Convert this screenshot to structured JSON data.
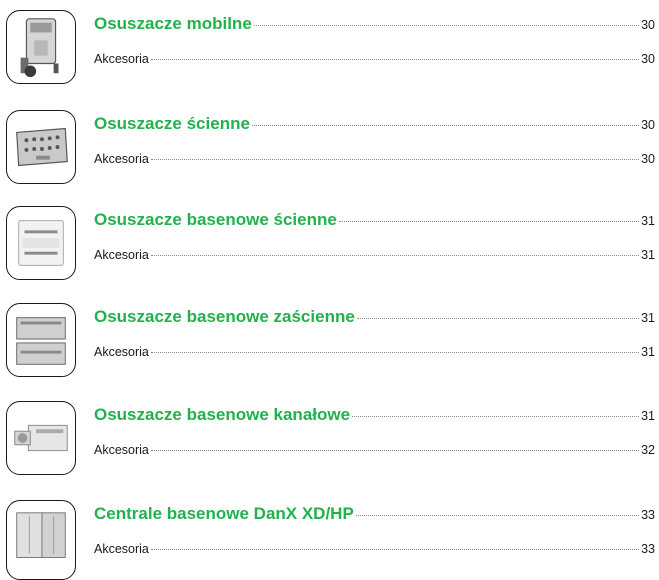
{
  "sections": [
    {
      "title": "Osuszacze mobilne",
      "title_page": "30",
      "sub_label": "Akcesoria",
      "sub_page": "30",
      "image": "mobile-dehumidifier-icon"
    },
    {
      "title": "Osuszacze ścienne",
      "title_page": "30",
      "sub_label": "Akcesoria",
      "sub_page": "30",
      "image": "wall-dehumidifier-icon"
    },
    {
      "title": "Osuszacze basenowe ścienne",
      "title_page": "31",
      "sub_label": "Akcesoria",
      "sub_page": "31",
      "image": "pool-wall-dehumidifier-icon"
    },
    {
      "title": "Osuszacze basenowe zaścienne",
      "title_page": "31",
      "sub_label": "Akcesoria",
      "sub_page": "31",
      "image": "pool-behind-wall-dehumidifier-icon"
    },
    {
      "title": "Osuszacze basenowe kanałowe",
      "title_page": "31",
      "sub_label": "Akcesoria",
      "sub_page": "32",
      "image": "pool-duct-dehumidifier-icon"
    },
    {
      "title": "Centrale basenowe DanX XD/HP",
      "title_page": "33",
      "sub_label": "Akcesoria",
      "sub_page": "33",
      "image": "pool-air-handling-unit-icon"
    }
  ],
  "colors": {
    "accent": "#22b14c",
    "text": "#1a1a1a",
    "leader": "#8a8a8a"
  }
}
